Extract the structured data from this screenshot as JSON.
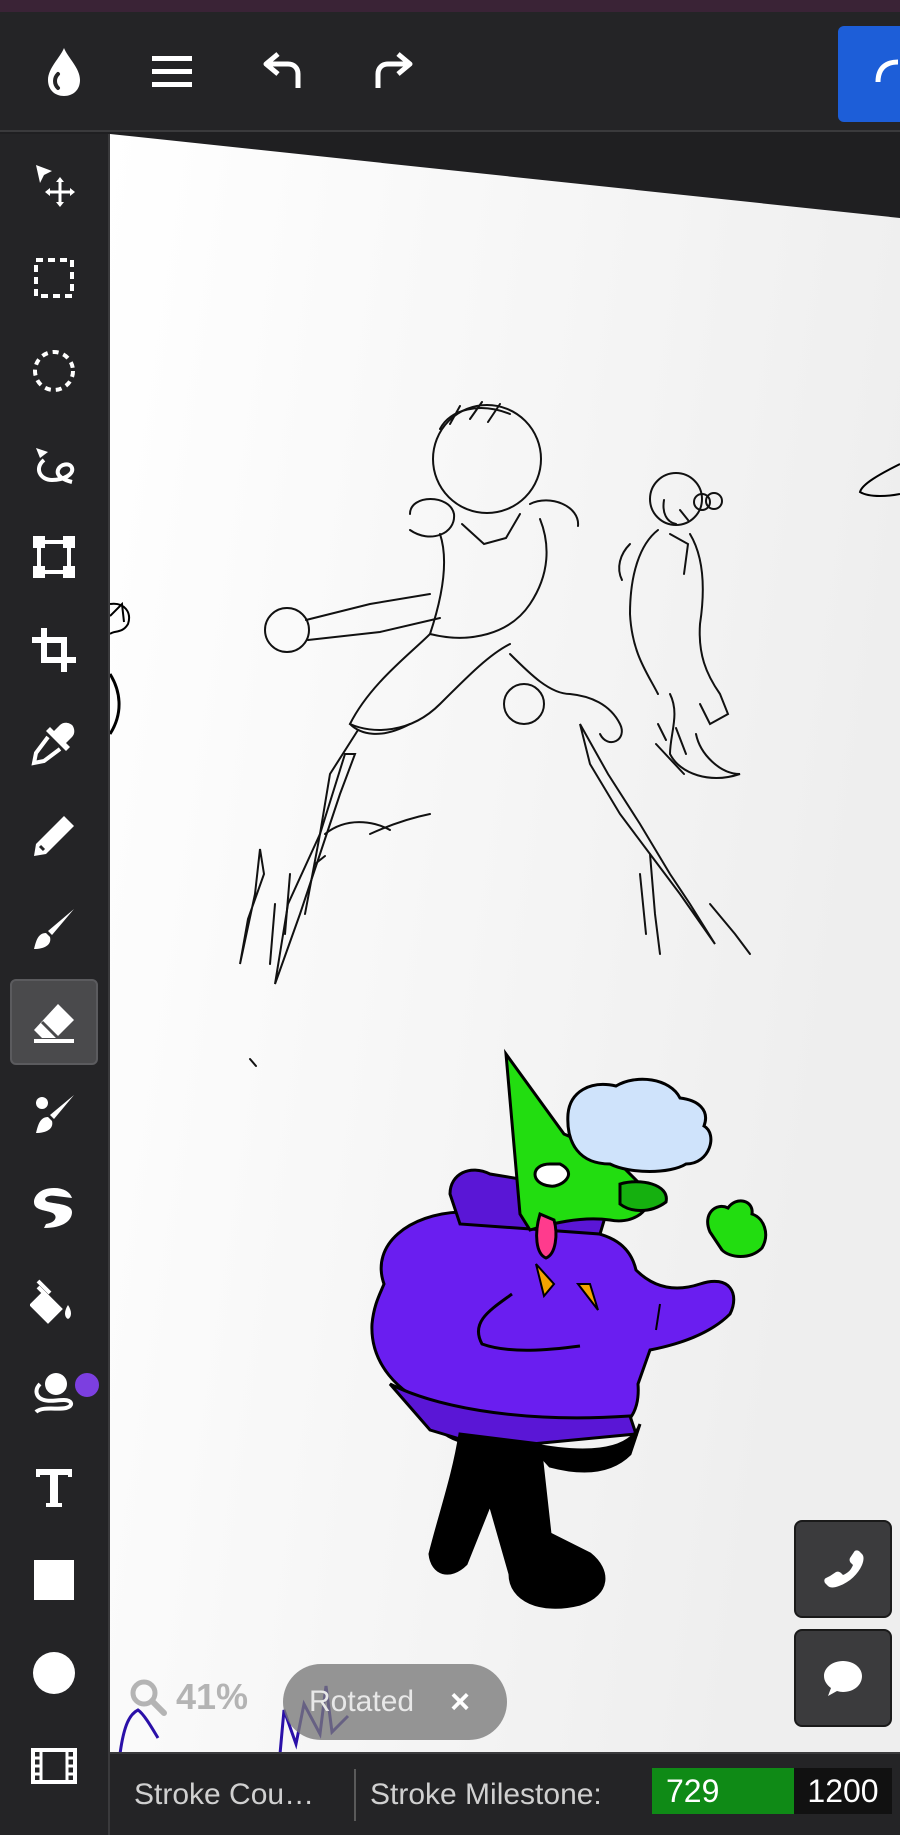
{
  "toolbar": {
    "logo_icon": "app-logo-icon",
    "menu_icon": "hamburger-menu-icon",
    "undo_icon": "undo-icon",
    "redo_icon": "redo-icon",
    "primary_icon": "primary-action-icon",
    "primary_color": "#1d5ed8"
  },
  "tools": [
    {
      "id": "move",
      "icon": "move-icon"
    },
    {
      "id": "select-rect",
      "icon": "rect-select-icon"
    },
    {
      "id": "select-ellipse",
      "icon": "ellipse-select-icon"
    },
    {
      "id": "lasso",
      "icon": "lasso-icon"
    },
    {
      "id": "transform",
      "icon": "transform-icon"
    },
    {
      "id": "crop",
      "icon": "crop-icon"
    },
    {
      "id": "eyedropper",
      "icon": "eyedropper-icon"
    },
    {
      "id": "pencil",
      "icon": "pencil-icon"
    },
    {
      "id": "brush",
      "icon": "brush-icon"
    },
    {
      "id": "eraser",
      "icon": "eraser-icon",
      "active": true
    },
    {
      "id": "blend",
      "icon": "blend-brush-icon"
    },
    {
      "id": "smudge",
      "icon": "smudge-icon"
    },
    {
      "id": "fill",
      "icon": "paint-bucket-icon"
    },
    {
      "id": "lasso-fill",
      "icon": "lasso-fill-icon"
    },
    {
      "id": "text",
      "icon": "text-icon"
    },
    {
      "id": "rectangle",
      "icon": "rectangle-icon"
    },
    {
      "id": "ellipse",
      "icon": "ellipse-icon"
    },
    {
      "id": "frames",
      "icon": "film-strip-icon"
    }
  ],
  "current_color": "#7c3fe0",
  "canvas": {
    "zoom_label": "41%",
    "rotated_label": "Rotated",
    "rotated_close": "×"
  },
  "float_buttons": {
    "call_icon": "phone-icon",
    "chat_icon": "chat-bubble-icon"
  },
  "status": {
    "stroke_count_label": "Stroke Cou…",
    "milestone_label": "Stroke Milestone:",
    "milestone_current": "729",
    "milestone_target": "1200",
    "milestone_progress": 0.6075,
    "milestone_color": "#0f8a16"
  }
}
